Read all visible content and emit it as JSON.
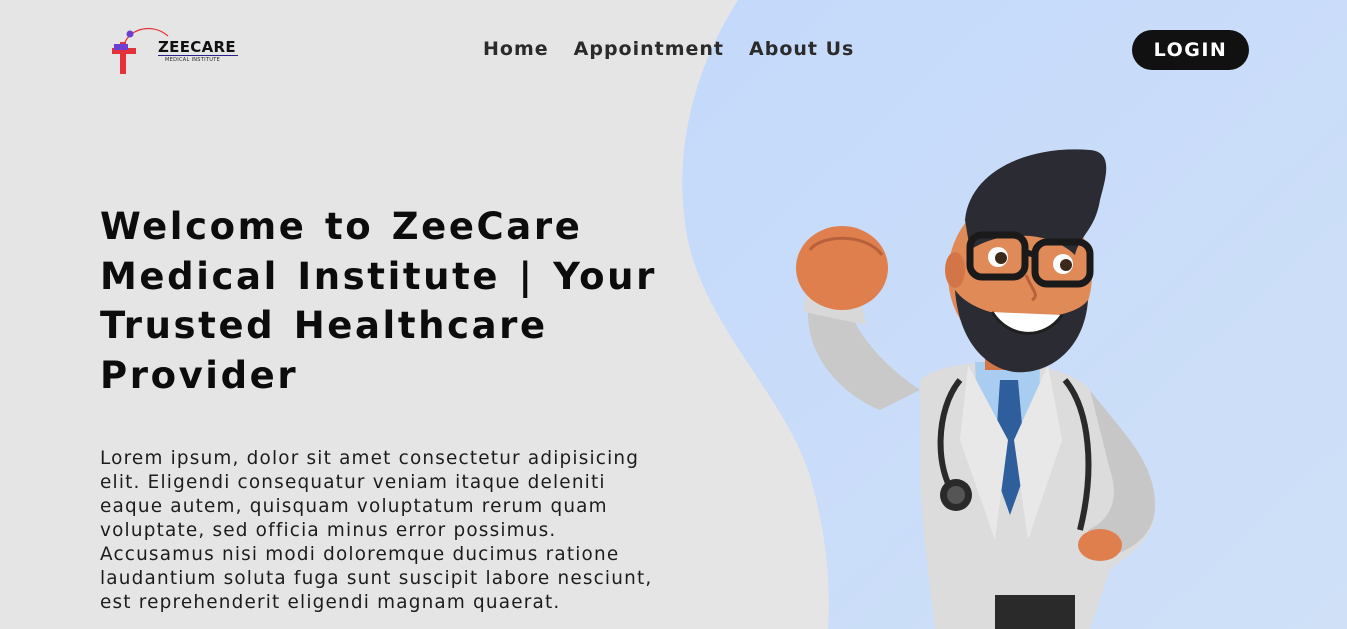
{
  "brand": {
    "name": "ZEECARE",
    "tagline": "MEDICAL INSTITUTE"
  },
  "nav": {
    "links": [
      "Home",
      "Appointment",
      "About Us"
    ],
    "login_label": "LOGIN"
  },
  "hero": {
    "title": "Welcome to ZeeCare Medical Institute | Your Trusted Healthcare Provider",
    "description": "Lorem ipsum, dolor sit amet consectetur adipisicing elit. Eligendi consequatur veniam itaque deleniti eaque autem, quisquam voluptatum rerum quam voluptate, sed officia minus error possimus. Accusamus nisi modi doloremque ducimus ratione laudantium soluta fuga sunt suscipit labore nesciunt, est reprehenderit eligendi magnam quaerat."
  },
  "colors": {
    "background": "#e5e5e5",
    "accent_blob": "#c7dcfa",
    "button": "#111111",
    "logo_red": "#e53238",
    "logo_purple": "#6b3fd1"
  }
}
